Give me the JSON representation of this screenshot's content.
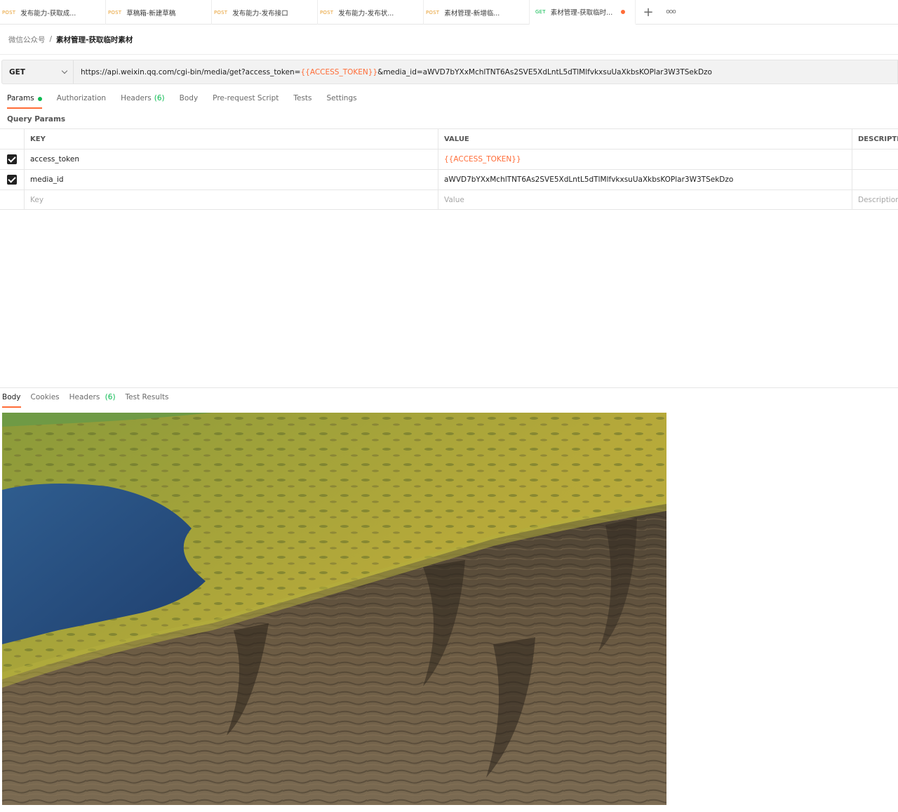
{
  "tabs": [
    {
      "method": "POST",
      "title": "发布能力-获取成..."
    },
    {
      "method": "POST",
      "title": "草稿箱-新建草稿"
    },
    {
      "method": "POST",
      "title": "发布能力-发布接口"
    },
    {
      "method": "POST",
      "title": "发布能力-发布状..."
    },
    {
      "method": "POST",
      "title": "素材管理-新增临..."
    },
    {
      "method": "GET",
      "title": "素材管理-获取临时..."
    }
  ],
  "tab_add_label": "+",
  "tab_more_label": "ooo",
  "breadcrumb": {
    "parent": "微信公众号",
    "separator": "/",
    "current": "素材管理-获取临时素材"
  },
  "request": {
    "method": "GET",
    "url_prefix": "https://api.weixin.qq.com/cgi-bin/media/get?access_token=",
    "url_var": "{{ACCESS_TOKEN}}",
    "url_suffix": "&media_id=aWVD7bYXxMchlTNT6As2SVE5XdLntL5dTlMlfvkxsuUaXkbsKOPlar3W3TSekDzo"
  },
  "request_tabs": {
    "params": "Params",
    "authorization": "Authorization",
    "headers": "Headers",
    "headers_count": "(6)",
    "body": "Body",
    "prerequest": "Pre-request Script",
    "tests": "Tests",
    "settings": "Settings"
  },
  "query_params": {
    "title": "Query Params",
    "headers": {
      "key": "KEY",
      "value": "VALUE",
      "description": "DESCRIPTIO"
    },
    "rows": [
      {
        "key": "access_token",
        "value": "{{ACCESS_TOKEN}}"
      },
      {
        "key": "media_id",
        "value": "aWVD7bYXxMchlTNT6As2SVE5XdLntL5dTlMlfvkxsuUaXkbsKOPlar3W3TSekDzo"
      }
    ],
    "placeholders": {
      "key": "Key",
      "value": "Value",
      "description": "Description"
    }
  },
  "response_tabs": {
    "body": "Body",
    "cookies": "Cookies",
    "headers": "Headers",
    "headers_count": "(6)",
    "test_results": "Test Results"
  },
  "colors": {
    "accent": "#ff6c37",
    "post": "#e8a033",
    "get": "#0cbb52"
  }
}
